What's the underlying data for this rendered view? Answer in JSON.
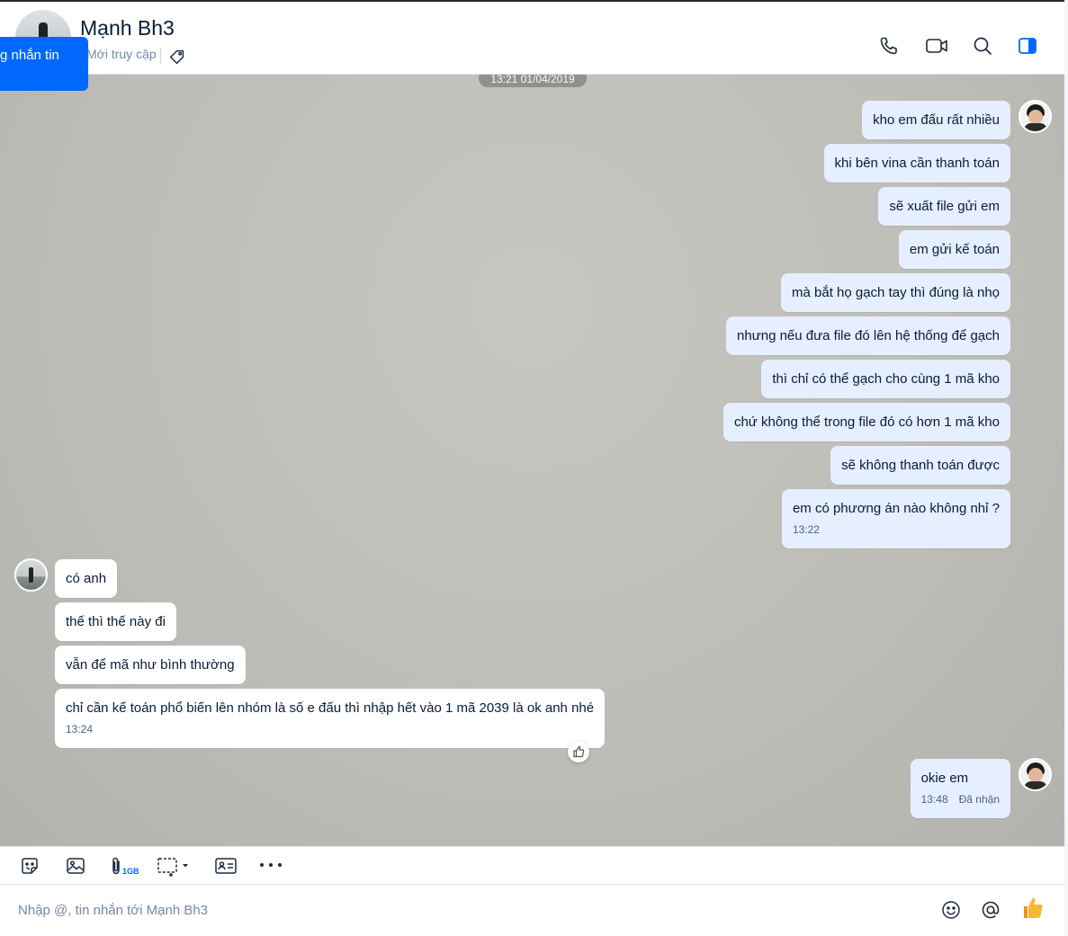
{
  "header": {
    "contact_name": "Mạnh Bh3",
    "last_access": "Mới truy cập",
    "blue_button_label": "g nhắn tin"
  },
  "chat": {
    "date_divider": "13:21 01/04/2019",
    "outgoing_group_1": [
      {
        "text": "kho em đấu rất nhiều"
      },
      {
        "text": "khi bên vina cần thanh toán"
      },
      {
        "text": "sẽ xuất file gửi em"
      },
      {
        "text": "em gửi kế toán"
      },
      {
        "text": "mà bắt họ gạch tay thì đúng là nhọ"
      },
      {
        "text": "nhưng nếu đưa file đó lên hệ thống để gạch"
      },
      {
        "text": "thì chỉ có thể gạch cho cùng 1 mã kho"
      },
      {
        "text": "chứ không thể trong file đó có hơn 1 mã kho"
      },
      {
        "text": "sẽ không thanh toán được"
      },
      {
        "text": "em có phương án nào không nhỉ ?",
        "time": "13:22"
      }
    ],
    "incoming_group": [
      {
        "text": "có anh"
      },
      {
        "text": "thế thì thế này đi"
      },
      {
        "text": "vẫn để mã như bình thường"
      },
      {
        "text": "chỉ cần kế toán phổ biến lên nhóm là số e đấu thì nhập hết vào 1 mã 2039 là ok anh nhé",
        "time": "13:24"
      }
    ],
    "outgoing_group_2": [
      {
        "text": "okie em",
        "time": "13:48",
        "status": "Đã nhận"
      }
    ]
  },
  "toolbar": {
    "attach_size_label": "1GB",
    "items": [
      "sticker-icon",
      "image-icon",
      "attach-icon",
      "screenshot-icon",
      "contact-card-icon",
      "more-icon"
    ]
  },
  "composer": {
    "placeholder": "Nhập @, tin nhắn tới Mạnh Bh3",
    "value": ""
  },
  "colors": {
    "accent": "#0068ff",
    "outgoing_bubble": "#e5efff",
    "incoming_bubble": "#ffffff",
    "like_thumb": "#f5a623"
  }
}
